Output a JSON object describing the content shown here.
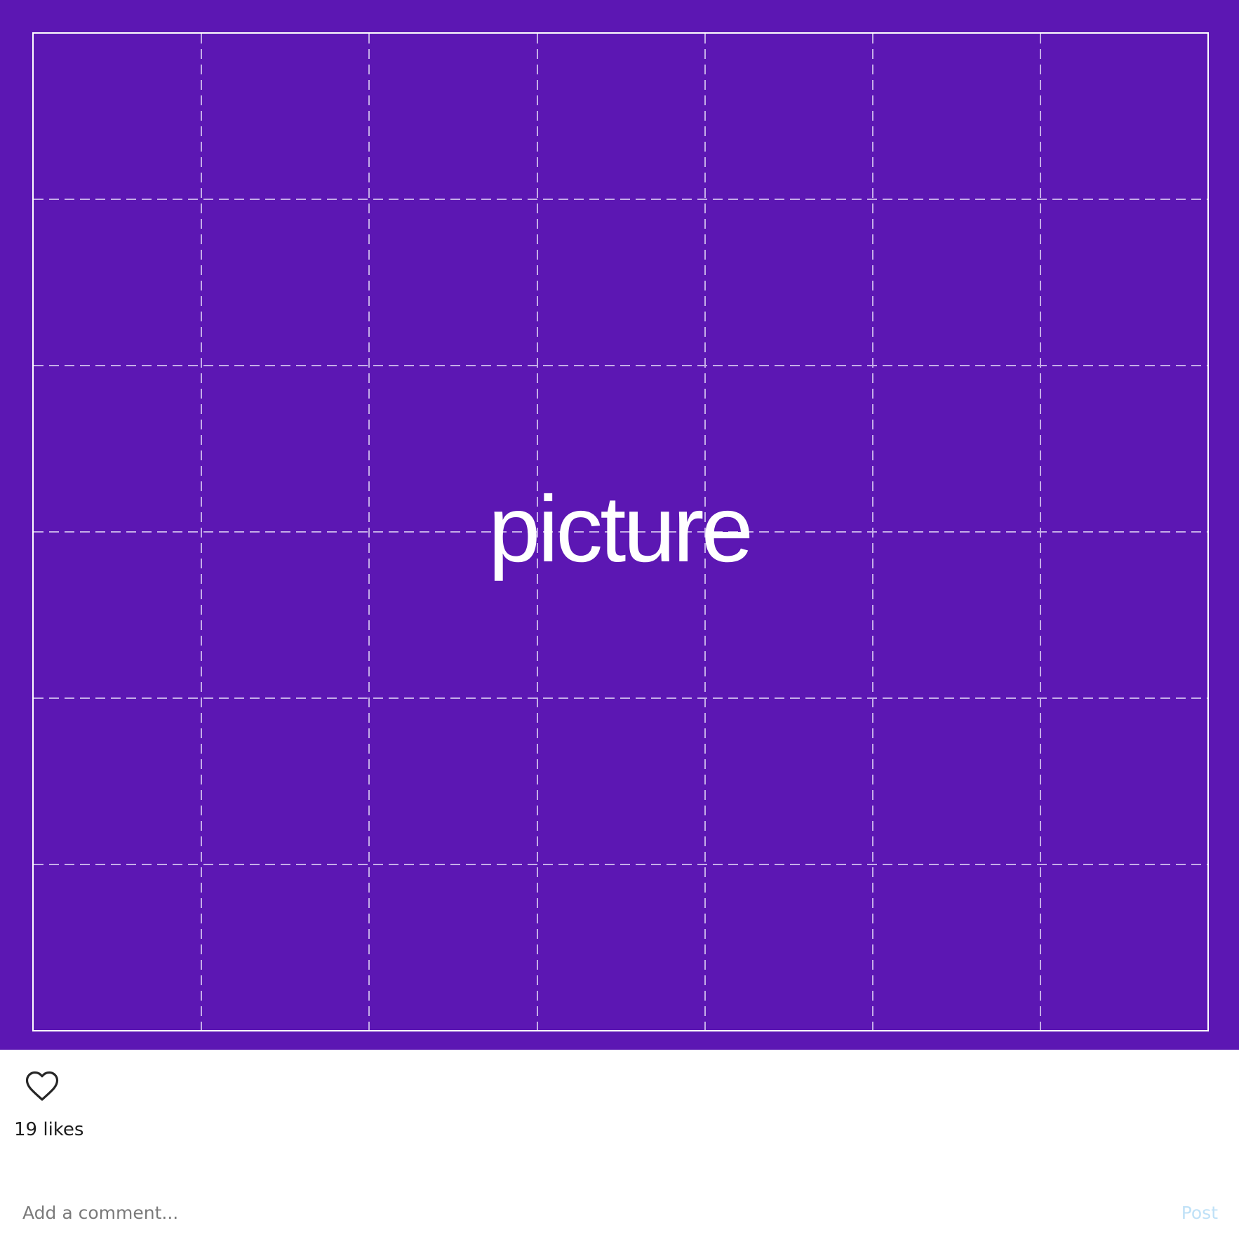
{
  "post": {
    "media": {
      "label": "picture",
      "background_color": "#5c17b3",
      "grid_color": "#d8c8f2"
    },
    "actions": {
      "like_icon": "heart-outline-icon"
    },
    "likes_text": "19 likes",
    "comment": {
      "placeholder": "Add a comment...",
      "value": "",
      "post_label": "Post"
    }
  }
}
